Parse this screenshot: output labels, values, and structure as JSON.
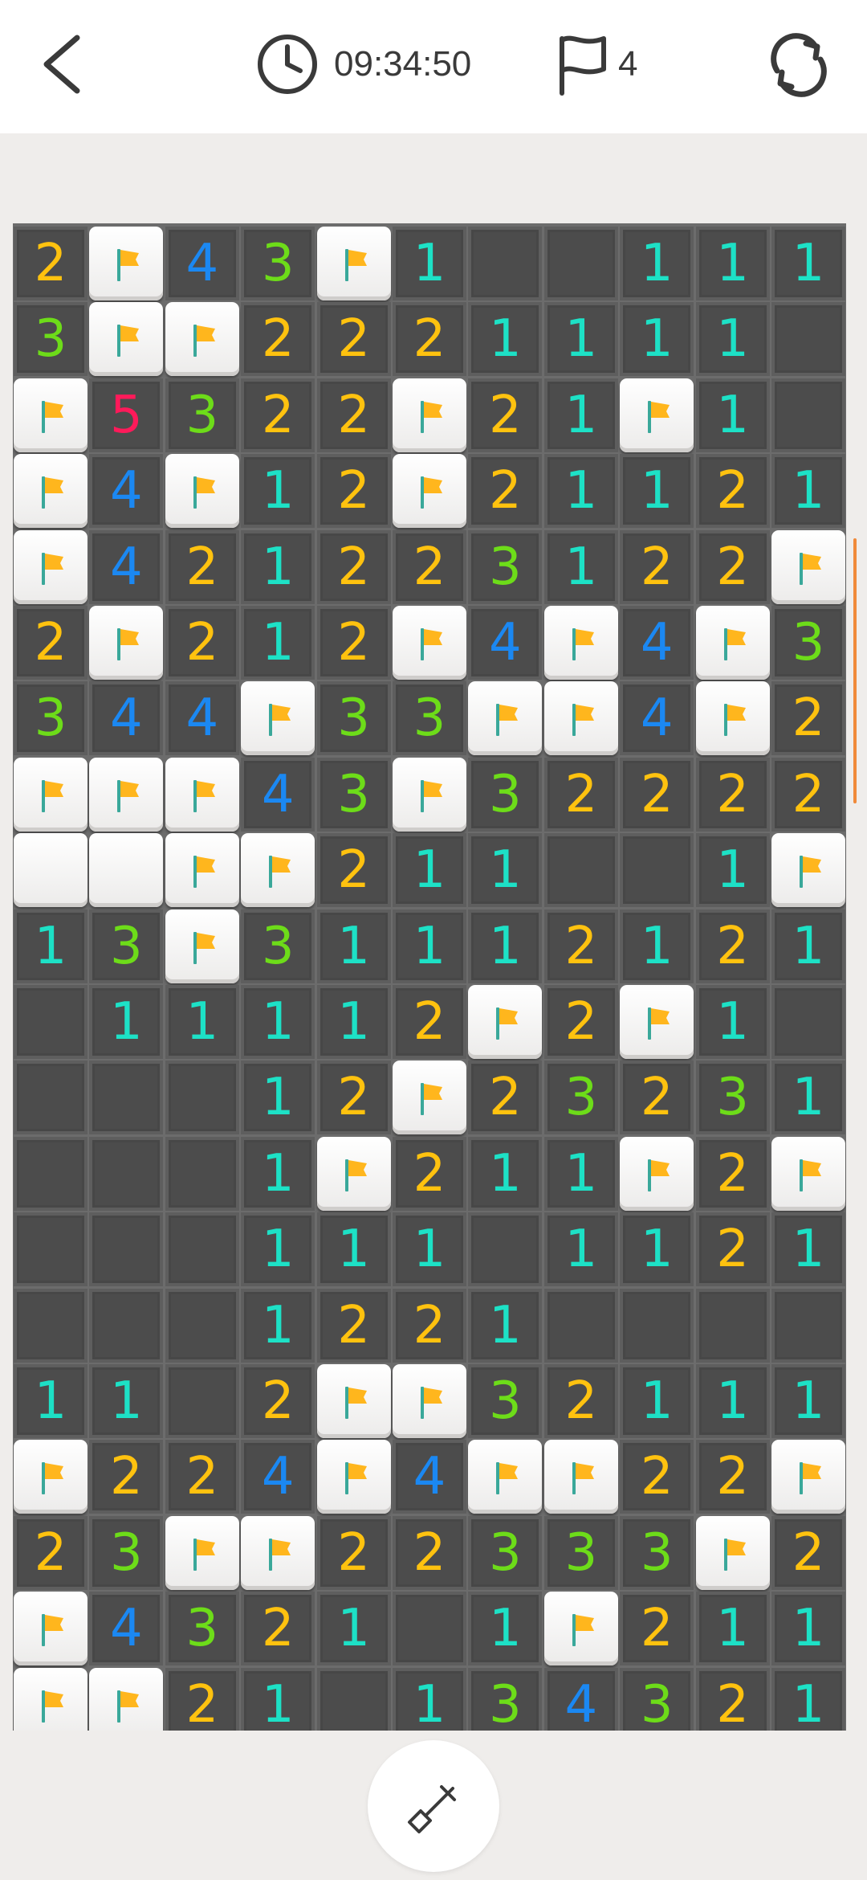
{
  "header": {
    "back_icon": "chevron-left-icon",
    "timer_icon": "clock-icon",
    "timer": "09:34:50",
    "flag_icon": "flag-outline-icon",
    "flags": "4",
    "restart_icon": "refresh-icon"
  },
  "board": {
    "columns": 11,
    "visible_rows": 20,
    "flag_color": "#ffb61d",
    "rows": [
      [
        "2",
        "F",
        "4",
        "3",
        "F",
        "1",
        "",
        "",
        "1",
        "1",
        "1"
      ],
      [
        "3",
        "F",
        "F",
        "2",
        "2",
        "2",
        "1",
        "1",
        "1",
        "1",
        ""
      ],
      [
        "F",
        "5",
        "3",
        "2",
        "2",
        "F",
        "2",
        "1",
        "F",
        "1",
        ""
      ],
      [
        "F",
        "4",
        "F",
        "1",
        "2",
        "F",
        "2",
        "1",
        "1",
        "2",
        "1"
      ],
      [
        "F",
        "4",
        "2",
        "1",
        "2",
        "2",
        "3",
        "1",
        "2",
        "2",
        "F"
      ],
      [
        "2",
        "F",
        "2",
        "1",
        "2",
        "F",
        "4",
        "F",
        "4",
        "F",
        "3"
      ],
      [
        "3",
        "4",
        "4",
        "F",
        "3",
        "3",
        "F",
        "F",
        "4",
        "F",
        "2"
      ],
      [
        "F",
        "F",
        "F",
        "4",
        "3",
        "F",
        "3",
        "2",
        "2",
        "2",
        "2"
      ],
      [
        "C",
        "C",
        "F",
        "F",
        "2",
        "1",
        "1",
        "",
        "",
        "1",
        "F"
      ],
      [
        "1",
        "3",
        "F",
        "3",
        "1",
        "1",
        "1",
        "2",
        "1",
        "2",
        "1"
      ],
      [
        "",
        "1",
        "1",
        "1",
        "1",
        "2",
        "F",
        "2",
        "F",
        "1",
        ""
      ],
      [
        "",
        "",
        "",
        "1",
        "2",
        "F",
        "2",
        "3",
        "2",
        "3",
        "1"
      ],
      [
        "",
        "",
        "",
        "1",
        "F",
        "2",
        "1",
        "1",
        "F",
        "2",
        "F"
      ],
      [
        "",
        "",
        "",
        "1",
        "1",
        "1",
        "",
        "1",
        "1",
        "2",
        "1"
      ],
      [
        "",
        "",
        "",
        "1",
        "2",
        "2",
        "1",
        "",
        "",
        "",
        ""
      ],
      [
        "1",
        "1",
        "",
        "2",
        "F",
        "F",
        "3",
        "2",
        "1",
        "1",
        "1"
      ],
      [
        "F",
        "2",
        "2",
        "4",
        "F",
        "4",
        "F",
        "F",
        "2",
        "2",
        "F"
      ],
      [
        "2",
        "3",
        "F",
        "F",
        "2",
        "2",
        "3",
        "3",
        "3",
        "F",
        "2"
      ],
      [
        "F",
        "4",
        "3",
        "2",
        "1",
        "",
        "1",
        "F",
        "2",
        "1",
        "1"
      ],
      [
        "F",
        "F",
        "2",
        "1",
        "",
        "1",
        "3",
        "4",
        "3",
        "2",
        "1"
      ]
    ]
  },
  "footer": {
    "dig_icon": "shovel-icon"
  }
}
